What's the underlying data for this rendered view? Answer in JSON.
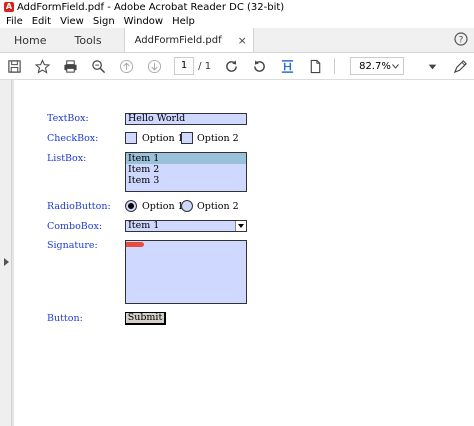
{
  "window": {
    "title": "AddFormField.pdf - Adobe Acrobat Reader DC (32-bit)",
    "icon": "acrobat-icon"
  },
  "menu": [
    "File",
    "Edit",
    "View",
    "Sign",
    "Window",
    "Help"
  ],
  "tabs": {
    "home": "Home",
    "tools": "Tools",
    "document": "AddFormField.pdf",
    "close": "×"
  },
  "toolbar": {
    "page_current": "1",
    "page_total": "/ 1",
    "zoom": "82.7%"
  },
  "form": {
    "textbox_label": "TextBox:",
    "textbox_value": "Hello World",
    "checkbox_label": "CheckBox:",
    "checkbox_options": [
      "Option 1",
      "Option 2"
    ],
    "listbox_label": "ListBox:",
    "listbox_items": [
      "Item 1",
      "Item 2",
      "Item 3"
    ],
    "listbox_selected": "Item 1",
    "radio_label": "RadioButton:",
    "radio_options": [
      "Option 1",
      "Option 2"
    ],
    "radio_selected": "Option 1",
    "combo_label": "ComboBox:",
    "combo_value": "Item 1",
    "signature_label": "Signature:",
    "button_label": "Button:",
    "submit_text": "Submit"
  },
  "colors": {
    "label_text": "#1f3bd3",
    "field_fill": "#cfd8ff",
    "list_selection": "#99c1da",
    "acrobat_red": "#d9221c",
    "active_tool_blue": "#2b6cd9"
  }
}
